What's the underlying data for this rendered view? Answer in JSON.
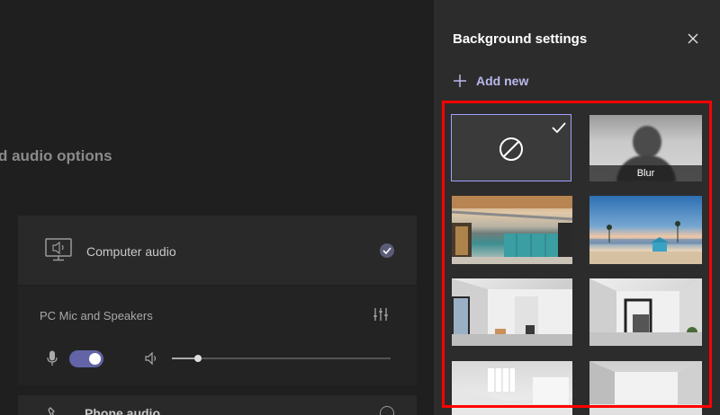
{
  "left": {
    "section_title": "d audio options",
    "computer_audio_label": "Computer audio",
    "mic_label": "PC Mic and Speakers",
    "phone_audio_label": "Phone audio",
    "volume_level_percent": 12,
    "mic_enabled": true
  },
  "panel": {
    "title": "Background settings",
    "add_new_label": "Add new",
    "blur_label": "Blur",
    "selected_option": "none"
  },
  "icons": [
    "computer-speaker-icon",
    "check-circle-icon",
    "equalizer-icon",
    "microphone-icon",
    "speaker-icon",
    "phone-icon",
    "close-icon",
    "plus-icon",
    "no-background-icon",
    "checkmark-icon"
  ],
  "colors": {
    "accent": "#6264a7",
    "accent_text": "#b8b9ec",
    "highlight": "#ff0000",
    "panel_bg": "#2d2c2c",
    "page_bg": "#1f1f1f"
  }
}
